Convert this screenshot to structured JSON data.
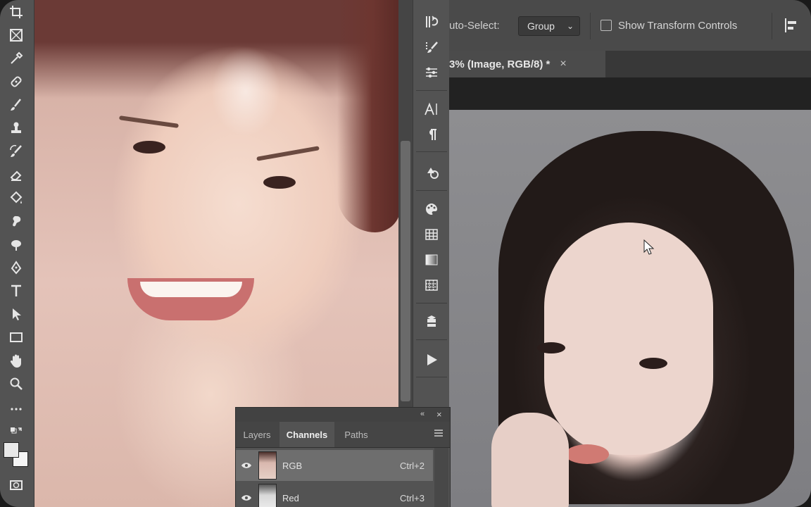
{
  "options_bar": {
    "auto_select_label": "uto-Select:",
    "group_value": "Group",
    "show_transform_label": "Show Transform Controls"
  },
  "document_tab": {
    "title": "3% (Image, RGB/8) *",
    "close_glyph": "×"
  },
  "channels_panel": {
    "tabs": [
      "Layers",
      "Channels",
      "Paths"
    ],
    "active_tab": "Channels",
    "collapse_glyph": "«",
    "close_glyph": "×",
    "rows": [
      {
        "name": "RGB",
        "shortcut": "Ctrl+2",
        "selected": true
      },
      {
        "name": "Red",
        "shortcut": "Ctrl+3",
        "selected": false
      }
    ]
  },
  "tools": [
    "crop-icon",
    "frame-icon",
    "eyedropper-icon",
    "healing-brush-icon",
    "brush-icon",
    "clone-stamp-icon",
    "history-brush-icon",
    "eraser-icon",
    "paint-bucket-icon",
    "smudge-icon",
    "dodge-icon",
    "pen-icon",
    "type-tool-icon",
    "path-selection-icon",
    "rectangle-icon",
    "hand-icon",
    "zoom-icon",
    "more-tools-icon"
  ],
  "dock_panels": [
    "history-icon",
    "brush-settings-icon",
    "adjustments-icon",
    "character-icon",
    "paragraph-icon",
    "3d-icon",
    "color-palette-icon",
    "swatches-grid-icon",
    "gradient-icon",
    "patterns-icon",
    "libraries-icon",
    "actions-play-icon"
  ],
  "colors": {
    "ui_dark": "#535353",
    "panel_selected": "#6e6e6e",
    "text": "#e2e2e2"
  }
}
